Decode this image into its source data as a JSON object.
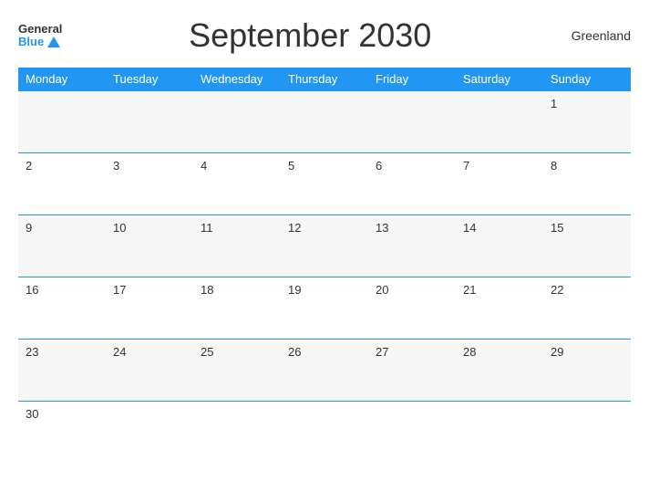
{
  "header": {
    "logo_general": "General",
    "logo_blue": "Blue",
    "title": "September 2030",
    "region": "Greenland"
  },
  "weekdays": [
    "Monday",
    "Tuesday",
    "Wednesday",
    "Thursday",
    "Friday",
    "Saturday",
    "Sunday"
  ],
  "weeks": [
    [
      "",
      "",
      "",
      "",
      "",
      "",
      "1"
    ],
    [
      "2",
      "3",
      "4",
      "5",
      "6",
      "7",
      "8"
    ],
    [
      "9",
      "10",
      "11",
      "12",
      "13",
      "14",
      "15"
    ],
    [
      "16",
      "17",
      "18",
      "19",
      "20",
      "21",
      "22"
    ],
    [
      "23",
      "24",
      "25",
      "26",
      "27",
      "28",
      "29"
    ],
    [
      "30",
      "",
      "",
      "",
      "",
      "",
      ""
    ]
  ]
}
